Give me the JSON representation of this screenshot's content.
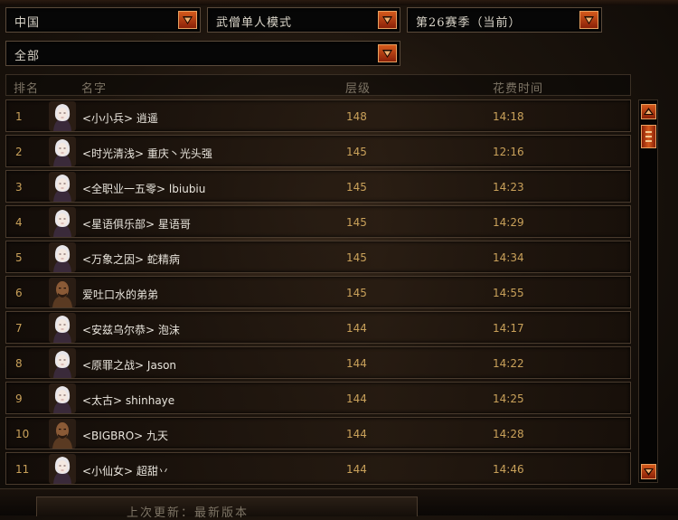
{
  "filters": {
    "region": "中国",
    "mode": "武僧单人模式",
    "season": "第26赛季（当前）",
    "category": "全部"
  },
  "table": {
    "headers": {
      "rank": "排名",
      "name": "名字",
      "level": "层级",
      "time": "花费时间"
    },
    "rows": [
      {
        "rank": "1",
        "name": "<小小兵> 逍遥",
        "level": "148",
        "time": "14:18",
        "avatar": "female-monk-portrait"
      },
      {
        "rank": "2",
        "name": "<时光清浅> 重庆丶光头强",
        "level": "145",
        "time": "12:16",
        "avatar": "female-monk-portrait"
      },
      {
        "rank": "3",
        "name": "<全职业一五零> lbiubiu",
        "level": "145",
        "time": "14:23",
        "avatar": "female-monk-portrait"
      },
      {
        "rank": "4",
        "name": "<星语俱乐部> 星语哥",
        "level": "145",
        "time": "14:29",
        "avatar": "female-monk-portrait"
      },
      {
        "rank": "5",
        "name": "<万象之因> 蛇精病",
        "level": "145",
        "time": "14:34",
        "avatar": "female-monk-portrait"
      },
      {
        "rank": "6",
        "name": "爱吐口水的弟弟",
        "level": "145",
        "time": "14:55",
        "avatar": "male-monk-portrait"
      },
      {
        "rank": "7",
        "name": "<安兹乌尔恭> 泡沫",
        "level": "144",
        "time": "14:17",
        "avatar": "female-monk-portrait"
      },
      {
        "rank": "8",
        "name": "<原罪之战> Jason",
        "level": "144",
        "time": "14:22",
        "avatar": "female-monk-portrait"
      },
      {
        "rank": "9",
        "name": "<太古> shinhaye",
        "level": "144",
        "time": "14:25",
        "avatar": "female-monk-portrait"
      },
      {
        "rank": "10",
        "name": "<BIGBRO> 九天",
        "level": "144",
        "time": "14:28",
        "avatar": "male-monk-portrait"
      },
      {
        "rank": "11",
        "name": "<小仙女> 超甜丷",
        "level": "144",
        "time": "14:46",
        "avatar": "female-monk-portrait"
      }
    ]
  },
  "footer": {
    "last_update": "上次更新：最新版本"
  },
  "colors": {
    "accent": "#c9a15a",
    "button": "#d55a1c",
    "text": "#e8e4dc"
  }
}
